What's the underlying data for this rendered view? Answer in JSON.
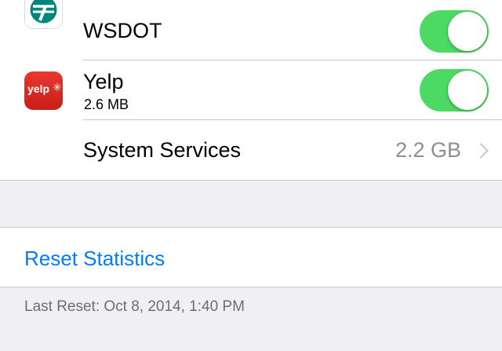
{
  "apps": [
    {
      "name": "WSDOT",
      "size": "",
      "enabled": true,
      "icon": "wsdot-logo"
    },
    {
      "name": "Yelp",
      "size": "2.6 MB",
      "enabled": true,
      "icon": "yelp-logo",
      "icon_text": "yelp"
    }
  ],
  "system_services": {
    "label": "System Services",
    "value": "2.2 GB",
    "icon": "chevron-right-icon"
  },
  "reset": {
    "label": "Reset Statistics"
  },
  "footer": {
    "last_reset": "Last Reset: Oct 8, 2014, 1:40 PM"
  },
  "colors": {
    "toggle_on": "#4cd964",
    "link": "#007aff",
    "secondary_text": "#8e8e93",
    "background": "#efeff4",
    "wsdot_green": "#00857a",
    "yelp_red": "#d32323"
  }
}
